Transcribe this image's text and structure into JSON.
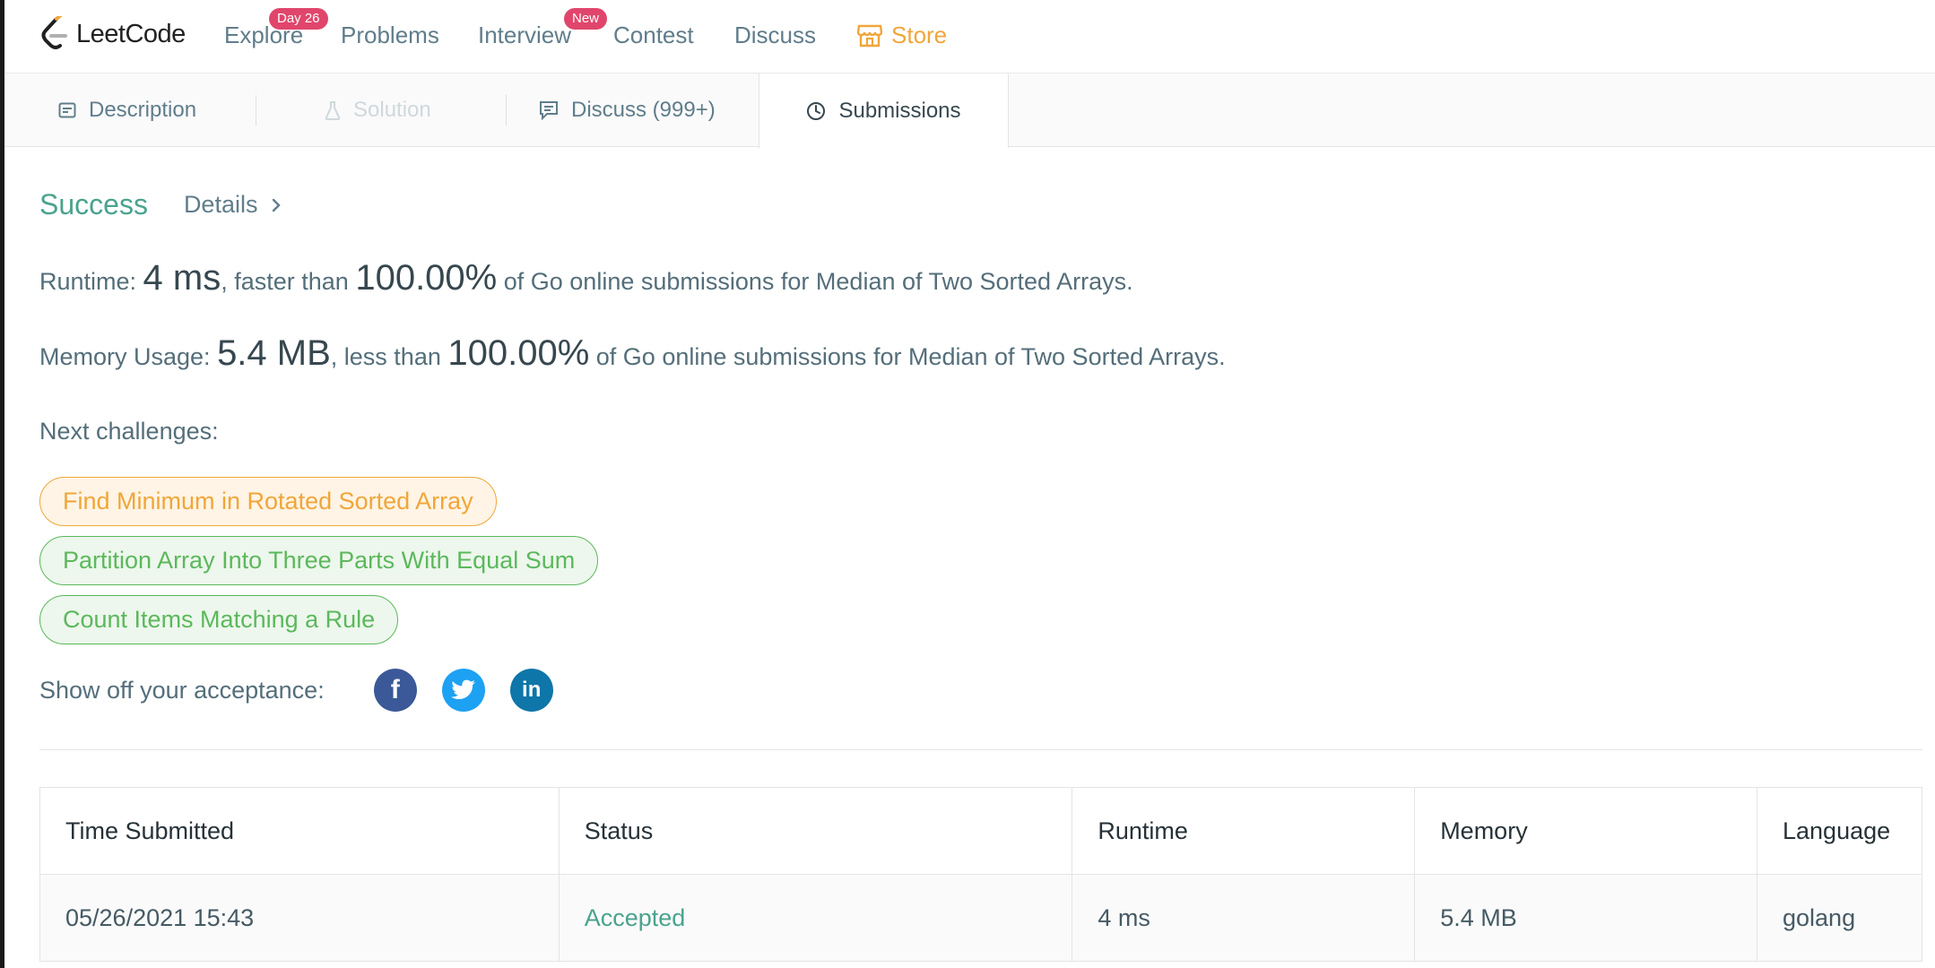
{
  "navbar": {
    "logo_text": "LeetCode",
    "items": [
      {
        "label": "Explore",
        "badge": "Day 26"
      },
      {
        "label": "Problems"
      },
      {
        "label": "Interview",
        "badge": "New"
      },
      {
        "label": "Contest"
      },
      {
        "label": "Discuss"
      },
      {
        "label": "Store",
        "icon": "store-icon"
      }
    ],
    "colors": {
      "badge": "#e0466c",
      "store": "#f0a63a"
    }
  },
  "tabs": [
    {
      "label": "Description",
      "icon": "description-icon"
    },
    {
      "label": "Solution",
      "icon": "flask-icon",
      "disabled": true
    },
    {
      "label": "Discuss (999+)",
      "icon": "comment-icon"
    },
    {
      "label": "Submissions",
      "icon": "clock-icon",
      "active": true
    }
  ],
  "result": {
    "status": "Success",
    "details_label": "Details",
    "runtime": {
      "prefix": "Runtime: ",
      "value": "4 ms",
      "mid": ", faster than ",
      "percent": "100.00%",
      "suffix": " of Go online submissions for Median of Two Sorted Arrays."
    },
    "memory": {
      "prefix": "Memory Usage: ",
      "value": "5.4 MB",
      "mid": ", less than ",
      "percent": "100.00%",
      "suffix": " of Go online submissions for Median of Two Sorted Arrays."
    },
    "status_color": "#4aa38e"
  },
  "next_challenges": {
    "label": "Next challenges:",
    "items": [
      {
        "title": "Find Minimum in Rotated Sorted Array",
        "difficulty": "medium"
      },
      {
        "title": "Partition Array Into Three Parts With Equal Sum",
        "difficulty": "easy"
      },
      {
        "title": "Count Items Matching a Rule",
        "difficulty": "easy"
      }
    ]
  },
  "share": {
    "label": "Show off your acceptance:",
    "buttons": [
      "facebook-icon",
      "twitter-icon",
      "linkedin-icon"
    ]
  },
  "table": {
    "headers": [
      "Time Submitted",
      "Status",
      "Runtime",
      "Memory",
      "Language"
    ],
    "rows": [
      [
        "05/26/2021 15:43",
        "Accepted",
        "4 ms",
        "5.4 MB",
        "golang"
      ]
    ]
  }
}
